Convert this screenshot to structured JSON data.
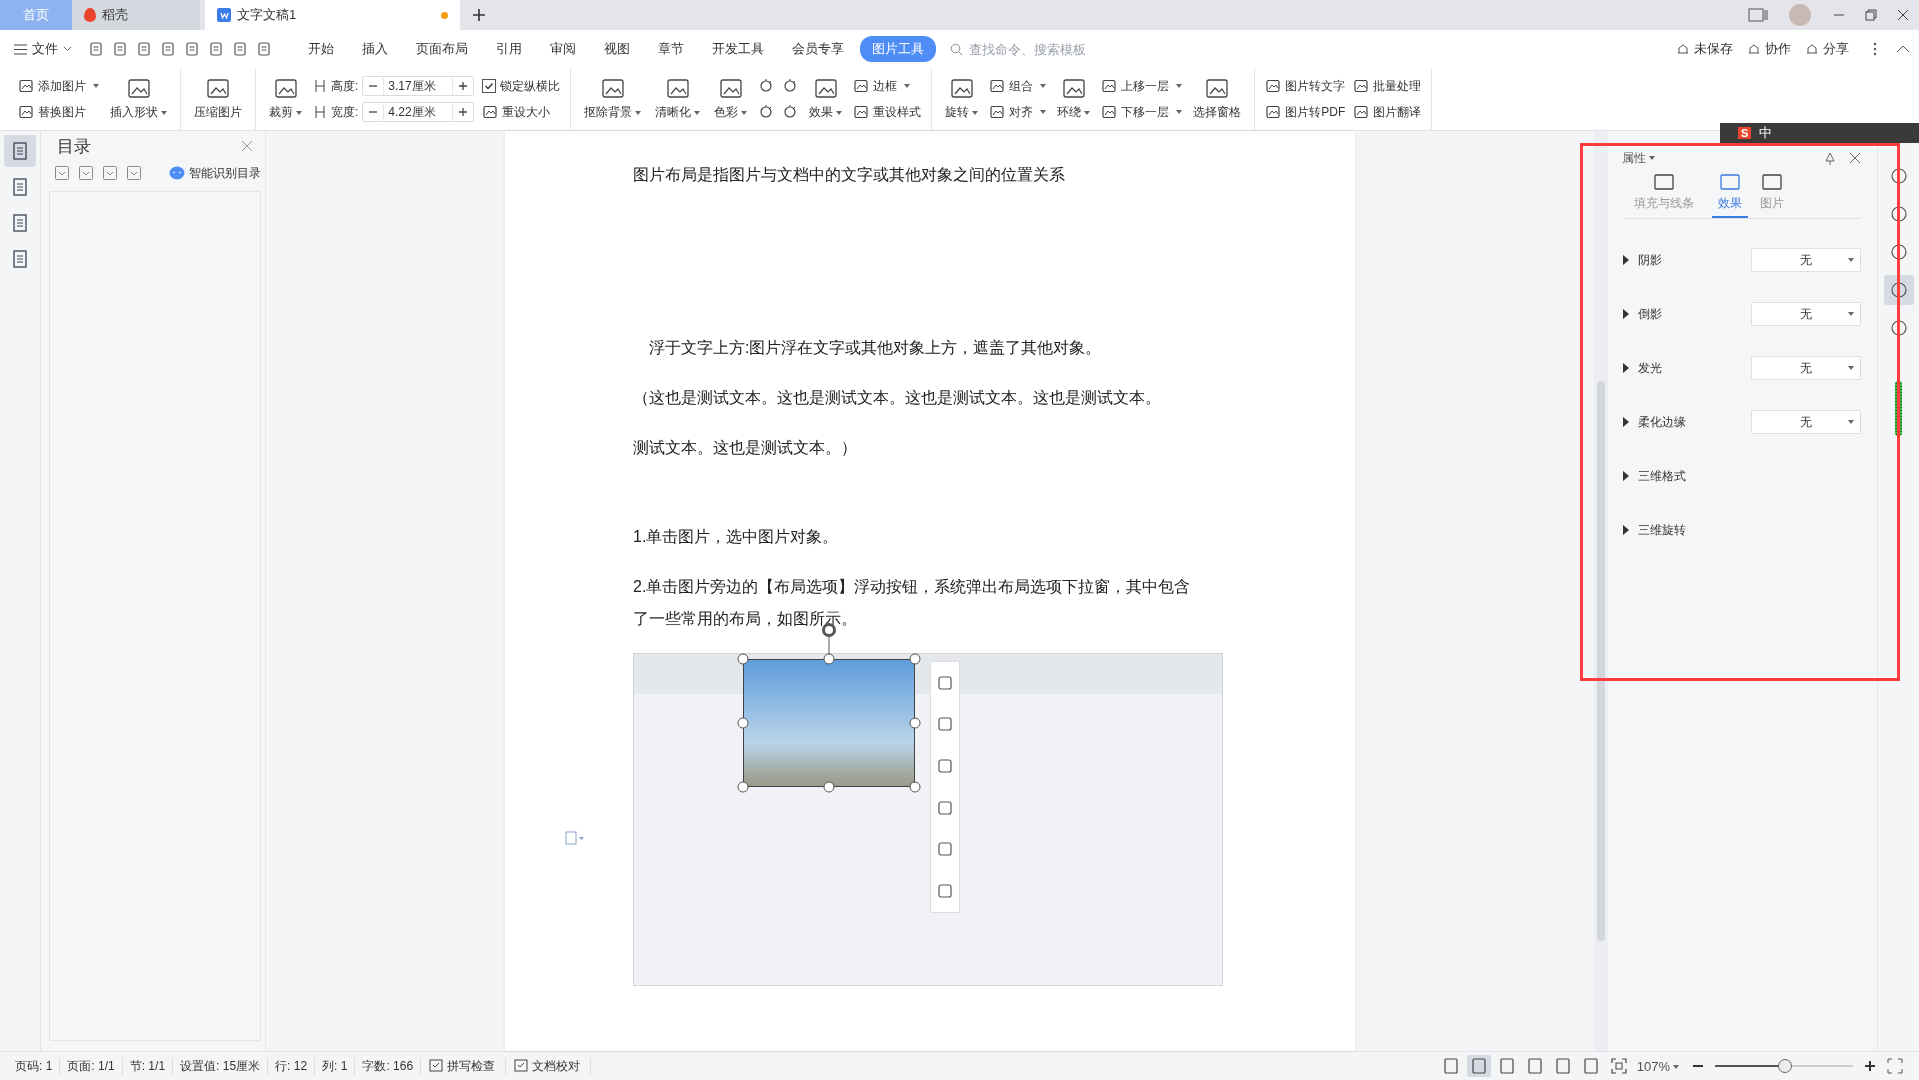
{
  "tabs": [
    {
      "label": "首页",
      "selected": false,
      "kind": "home",
      "modified": false
    },
    {
      "label": "稻壳",
      "selected": false,
      "kind": "app",
      "modified": false
    },
    {
      "label": "文字文稿1",
      "selected": true,
      "kind": "doc",
      "modified": true
    }
  ],
  "menu": {
    "file": "文件",
    "items": [
      {
        "label": "开始",
        "selected": false
      },
      {
        "label": "插入",
        "selected": false
      },
      {
        "label": "页面布局",
        "selected": false
      },
      {
        "label": "引用",
        "selected": false
      },
      {
        "label": "审阅",
        "selected": false
      },
      {
        "label": "视图",
        "selected": false
      },
      {
        "label": "章节",
        "selected": false
      },
      {
        "label": "开发工具",
        "selected": false
      },
      {
        "label": "会员专享",
        "selected": false
      },
      {
        "label": "图片工具",
        "selected": true
      }
    ],
    "search": {
      "placeholder": "查找命令、搜索模板"
    },
    "actions": [
      "未保存",
      "协作",
      "分享"
    ]
  },
  "ribbon": [
    {
      "tools": [
        {
          "kind": "stack",
          "items": [
            {
              "label": "添加图片",
              "dropdown": true
            },
            {
              "label": "替换图片",
              "dropdown": false
            }
          ]
        },
        {
          "kind": "large",
          "label": "插入形状",
          "dropdown": true
        }
      ]
    },
    {
      "tools": [
        {
          "kind": "large",
          "label": "压缩图片",
          "dropdown": false
        }
      ]
    },
    {
      "tools": [
        {
          "kind": "large",
          "label": "裁剪",
          "dropdown": true
        },
        {
          "kind": "size",
          "fields": [
            {
              "label": "高度:",
              "value": "3.17厘米"
            },
            {
              "label": "宽度:",
              "value": "4.22厘米"
            }
          ]
        },
        {
          "kind": "stack",
          "items": [
            {
              "kind": "checkbox",
              "label": "锁定纵横比",
              "checked": true,
              "dropdown": false
            },
            {
              "label": "重设大小",
              "dropdown": false
            }
          ]
        }
      ]
    },
    {
      "tools": [
        {
          "kind": "large",
          "label": "抠除背景",
          "dropdown": true
        },
        {
          "kind": "large",
          "label": "清晰化",
          "dropdown": true
        },
        {
          "kind": "large",
          "label": "色彩",
          "dropdown": true
        },
        {
          "kind": "stack",
          "items": [
            {
              "kind": "icon"
            },
            {
              "kind": "icon"
            }
          ]
        },
        {
          "kind": "stack",
          "items": [
            {
              "kind": "icon"
            },
            {
              "kind": "icon"
            }
          ]
        },
        {
          "kind": "large",
          "label": "效果",
          "dropdown": true
        },
        {
          "kind": "stack",
          "items": [
            {
              "label": "边框",
              "dropdown": true
            },
            {
              "label": "重设样式",
              "dropdown": false
            }
          ]
        }
      ]
    },
    {
      "tools": [
        {
          "kind": "large",
          "label": "旋转",
          "dropdown": true
        },
        {
          "kind": "stack",
          "items": [
            {
              "label": "组合",
              "dropdown": true
            },
            {
              "label": "对齐",
              "dropdown": true
            }
          ]
        },
        {
          "kind": "large",
          "label": "环绕",
          "dropdown": true
        },
        {
          "kind": "stack",
          "items": [
            {
              "label": "上移一层",
              "dropdown": true
            },
            {
              "label": "下移一层",
              "dropdown": true
            }
          ]
        },
        {
          "kind": "large",
          "label": "选择窗格",
          "dropdown": false
        }
      ]
    },
    {
      "tools": [
        {
          "kind": "stack",
          "items": [
            {
              "label": "图片转文字",
              "dropdown": false
            },
            {
              "label": "图片转PDF",
              "dropdown": false
            }
          ]
        },
        {
          "kind": "stack",
          "items": [
            {
              "label": "批量处理",
              "dropdown": false
            },
            {
              "label": "图片翻译",
              "dropdown": false
            }
          ]
        }
      ]
    }
  ],
  "ime": {
    "logo": "S",
    "label": "中"
  },
  "rail": [
    {
      "selected": true
    },
    {
      "selected": false
    },
    {
      "selected": false
    },
    {
      "selected": false
    }
  ],
  "toc": {
    "title": "目录",
    "smart": "智能识别目录"
  },
  "document": {
    "paragraphs": [
      {
        "text": "图片布局是指图片与文档中的文字或其他对象之间的位置关系",
        "kind": "title"
      },
      {
        "text": "浮于文字上方:图片浮在文字或其他对象上方，遮盖了其他对象。",
        "kind": "indent"
      },
      {
        "text": "（这也是测试文本。这也是测试文本。这也是测试文本。这也是测试文本。",
        "kind": "body"
      },
      {
        "text": "测试文本。这也是测试文本。）",
        "kind": "body"
      },
      {
        "text": "1.单击图片，选中图片对象。",
        "kind": "step"
      },
      {
        "text": "2.单击图片旁边的【布局选项】浮动按钮，系统弹出布局选项下拉窗，其中包含了一些常用的布局，如图所示。",
        "kind": "body"
      }
    ]
  },
  "properties": {
    "title": "属性",
    "tabs": [
      {
        "label": "填充与线条",
        "selected": false
      },
      {
        "label": "效果",
        "selected": true
      },
      {
        "label": "图片",
        "selected": false
      }
    ],
    "rows": [
      {
        "label": "阴影",
        "kind": "select",
        "value": "无"
      },
      {
        "label": "倒影",
        "kind": "select",
        "value": "无"
      },
      {
        "label": "发光",
        "kind": "select",
        "value": "无"
      },
      {
        "label": "柔化边缘",
        "kind": "select",
        "value": "无"
      },
      {
        "label": "三维格式",
        "kind": "plain"
      },
      {
        "label": "三维旋转",
        "kind": "plain"
      }
    ]
  },
  "right_rail": [
    {
      "selected": false
    },
    {
      "selected": false
    },
    {
      "selected": false
    },
    {
      "selected": true
    },
    {
      "selected": false
    }
  ],
  "status_bar": {
    "items": [
      "页码: 1",
      "页面: 1/1",
      "节: 1/1",
      "设置值: 15厘米",
      "行: 12",
      "列: 1",
      "字数: 166"
    ],
    "checks": [
      "拼写检查",
      "文档校对"
    ],
    "views": [
      {
        "selected": false
      },
      {
        "selected": true
      },
      {
        "selected": false
      },
      {
        "selected": false
      },
      {
        "selected": false
      },
      {
        "selected": false
      }
    ],
    "zoom": "107%",
    "zoom_slider": {
      "level": 0.51
    }
  }
}
